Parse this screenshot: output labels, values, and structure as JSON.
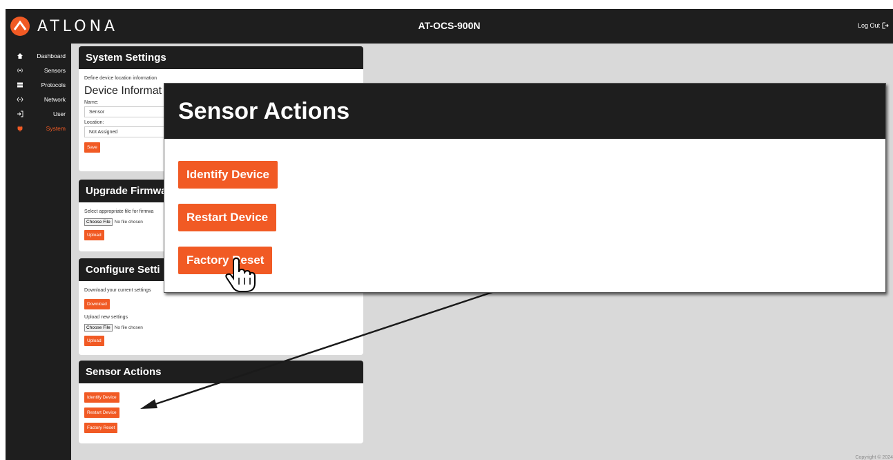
{
  "header": {
    "logo_text": "ATLONA",
    "device_name": "AT-OCS-900N",
    "logout_label": "Log Out"
  },
  "sidebar": {
    "items": [
      {
        "label": "Dashboard",
        "icon": "home-icon"
      },
      {
        "label": "Sensors",
        "icon": "broadcast-icon"
      },
      {
        "label": "Protocols",
        "icon": "server-icon"
      },
      {
        "label": "Network",
        "icon": "code-arrows-icon"
      },
      {
        "label": "User",
        "icon": "sign-in-icon"
      },
      {
        "label": "System",
        "icon": "plug-icon",
        "active": true
      }
    ]
  },
  "system_settings": {
    "title": "System Settings",
    "description": "Define device location information",
    "section_title": "Device Informat",
    "name_label": "Name:",
    "name_value": "Sensor",
    "location_label": "Location:",
    "location_value": "Not Assigned",
    "save_label": "Save"
  },
  "upgrade_firmware": {
    "title": "Upgrade Firmwa",
    "description": "Select appropriate file for firmwa",
    "choose_file_label": "Choose File",
    "no_file_text": "No file chosen",
    "upload_label": "Upload"
  },
  "configure_settings": {
    "title": "Configure Setti",
    "download_text": "Download your current settings",
    "download_label": "Download",
    "upload_text": "Upload new settings",
    "choose_file_label": "Choose File",
    "no_file_text": "No file chosen",
    "upload_label": "Upload"
  },
  "sensor_actions": {
    "title": "Sensor Actions",
    "identify_label": "Identify Device",
    "restart_label": "Restart Device",
    "factory_reset_label": "Factory Reset"
  },
  "zoom_callout": {
    "title": "Sensor Actions",
    "identify_label": "Identify Device",
    "restart_label": "Restart Device",
    "factory_reset_label": "Factory Reset"
  },
  "footer": {
    "copyright": "Copyright © 2024"
  },
  "colors": {
    "accent": "#f15a24",
    "dark": "#1e1e1e",
    "background": "#d9d9d9"
  }
}
